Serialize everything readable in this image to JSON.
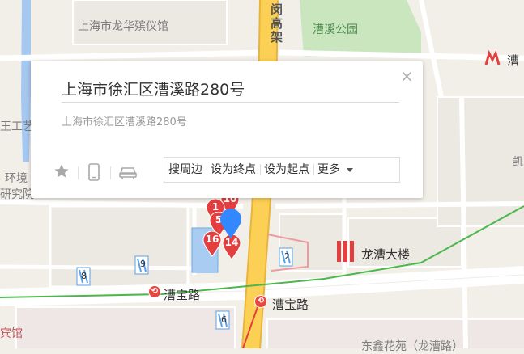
{
  "map_labels": {
    "funeral_home": "上海市龙华殡仪馆",
    "park": "漕溪公园",
    "hongqiao_left_vertical": "闵高架",
    "metro_top_right": "漕",
    "left_edge_1": "王工艺",
    "left_edge_2": "环境",
    "left_edge_3": "研究院",
    "right_edge": "凯",
    "building": "龙漕大楼",
    "road_1": "漕宝路",
    "road_2": "漕宝路",
    "bottom_left": "宾馆",
    "bottom_right": "东鑫花苑（龙漕路）"
  },
  "popup": {
    "title": "上海市徐汇区漕溪路280号",
    "address": "上海市徐汇区漕溪路280号",
    "close_glyph": "×",
    "actions": {
      "nearby": "搜周边",
      "set_end": "设为终点",
      "set_start": "设为起点",
      "more": "更多"
    }
  },
  "markers": {
    "pins": [
      "10",
      "1",
      "5",
      "16",
      "14"
    ],
    "metro_numbers": [
      "8",
      "9",
      "2",
      "6"
    ]
  },
  "colors": {
    "expressway": "#fccf55",
    "road_minor": "#ffffff",
    "park": "#c9e6be",
    "water": "#a6c8f0",
    "metro_line": "#4cb74c",
    "pin_red": "#e53e3e",
    "pin_blue": "#3388ff"
  }
}
